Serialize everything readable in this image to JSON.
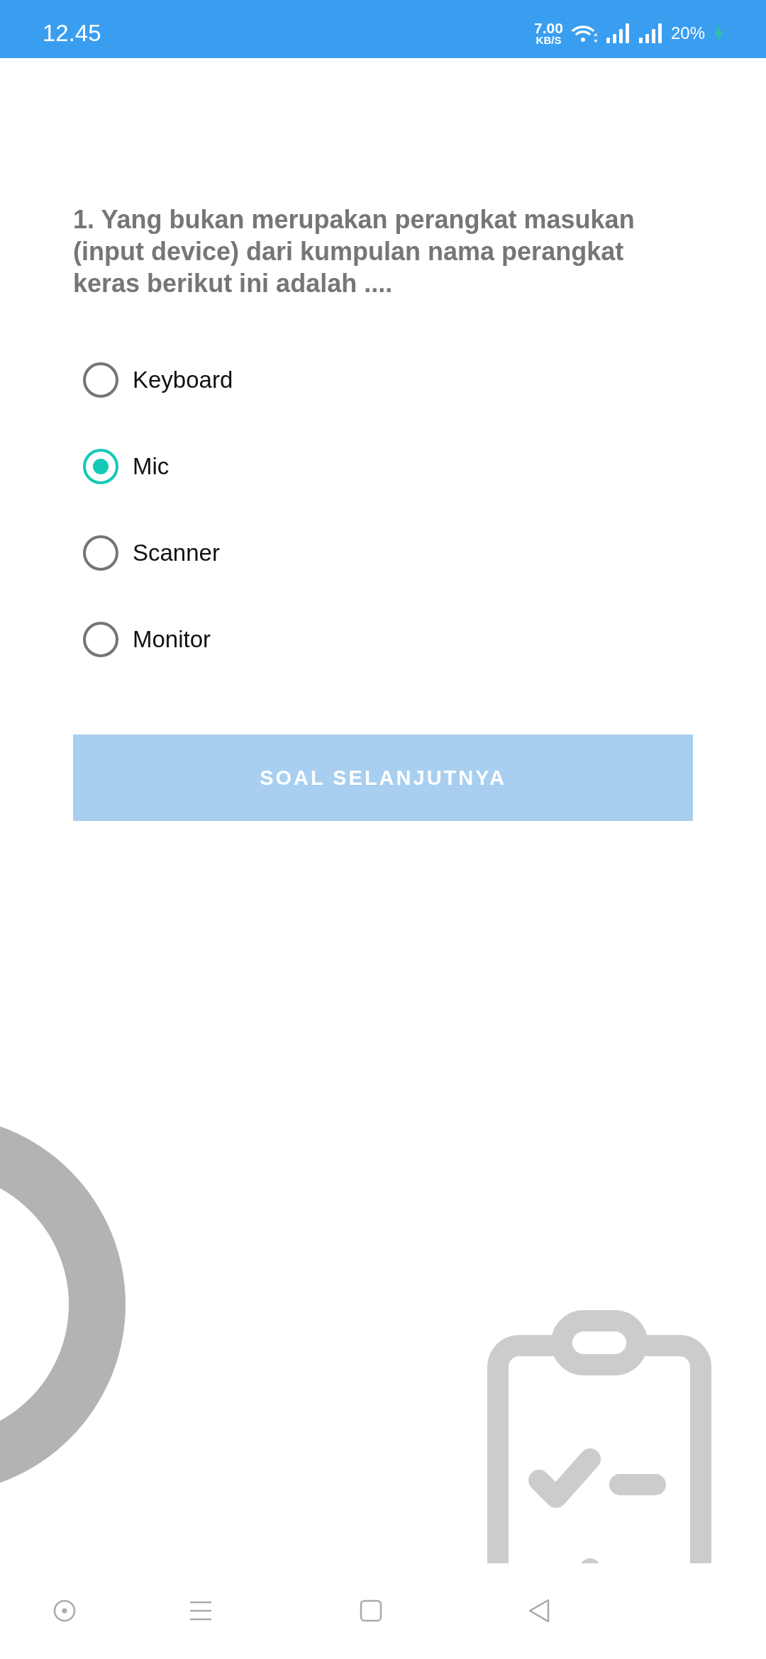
{
  "status_bar": {
    "time": "12.45",
    "speed": "7.00",
    "speed_unit": "KB/S",
    "battery": "20%",
    "charging": true
  },
  "question": "1. Yang bukan merupakan perangkat masukan (input device) dari kumpulan nama perangkat keras berikut ini adalah ....",
  "options": [
    {
      "label": "Keyboard",
      "selected": false
    },
    {
      "label": "Mic",
      "selected": true
    },
    {
      "label": "Scanner",
      "selected": false
    },
    {
      "label": "Monitor",
      "selected": false
    }
  ],
  "next_button": {
    "label": "SOAL SELANJUTNYA"
  }
}
